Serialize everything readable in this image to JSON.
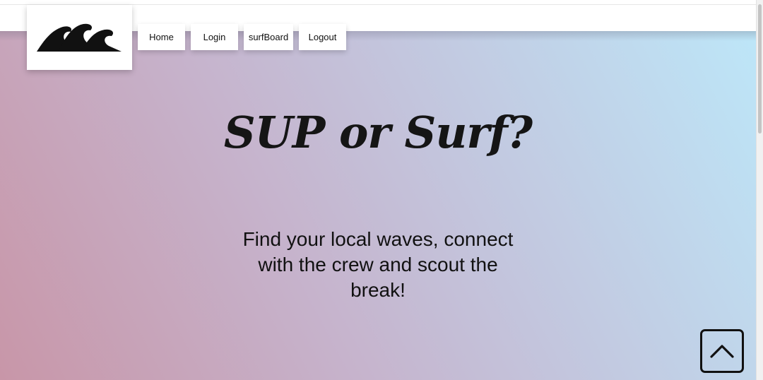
{
  "header": {
    "logo_icon": "waves-logo-icon",
    "nav": [
      {
        "label": "Home"
      },
      {
        "label": "Login"
      },
      {
        "label": "surfBoard"
      },
      {
        "label": "Logout"
      }
    ]
  },
  "hero": {
    "title": "SUP or Surf?",
    "subtitle": "Find your local waves, connect with the crew and scout the break!",
    "gradient_colors": [
      "#c896a8",
      "#c6b3cc",
      "#c3c5dd",
      "#bde6f8"
    ]
  },
  "back_to_top": {
    "icon": "chevron-up-icon"
  }
}
